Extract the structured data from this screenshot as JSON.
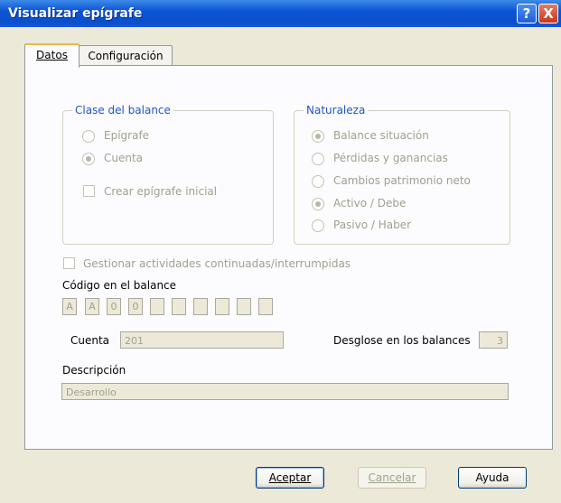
{
  "window": {
    "title": "Visualizar epígrafe",
    "help_btn": "?",
    "close_btn": "X"
  },
  "tabs": [
    {
      "label": "Datos"
    },
    {
      "label": "Configuración"
    }
  ],
  "clase_balance": {
    "title": "Clase del balance",
    "options": [
      {
        "label": "Epígrafe",
        "selected": false
      },
      {
        "label": "Cuenta",
        "selected": true
      }
    ],
    "crear_epigrafe": {
      "label": "Crear epígrafe inicial",
      "checked": false
    }
  },
  "naturaleza": {
    "title": "Naturaleza",
    "options": [
      {
        "label": "Balance situación",
        "selected": true
      },
      {
        "label": "Pérdidas y ganancias",
        "selected": false
      },
      {
        "label": "Cambios patrimonio neto",
        "selected": false
      },
      {
        "label": "Activo / Debe",
        "selected": true
      },
      {
        "label": "Pasivo / Haber",
        "selected": false
      }
    ]
  },
  "gestionar": {
    "label": "Gestionar actividades continuadas/interrumpidas",
    "checked": false
  },
  "codigo": {
    "label": "Código en el balance",
    "chars": [
      "A",
      "A",
      "0",
      "0",
      "",
      "",
      "",
      "",
      "",
      ""
    ]
  },
  "cuenta": {
    "label": "Cuenta",
    "value": "201"
  },
  "desglose": {
    "label": "Desglose en los balances",
    "value": "3"
  },
  "descripcion": {
    "label": "Descripción",
    "value": "Desarrollo"
  },
  "buttons": {
    "aceptar": "Aceptar",
    "cancelar": "Cancelar",
    "ayuda": "Ayuda"
  }
}
